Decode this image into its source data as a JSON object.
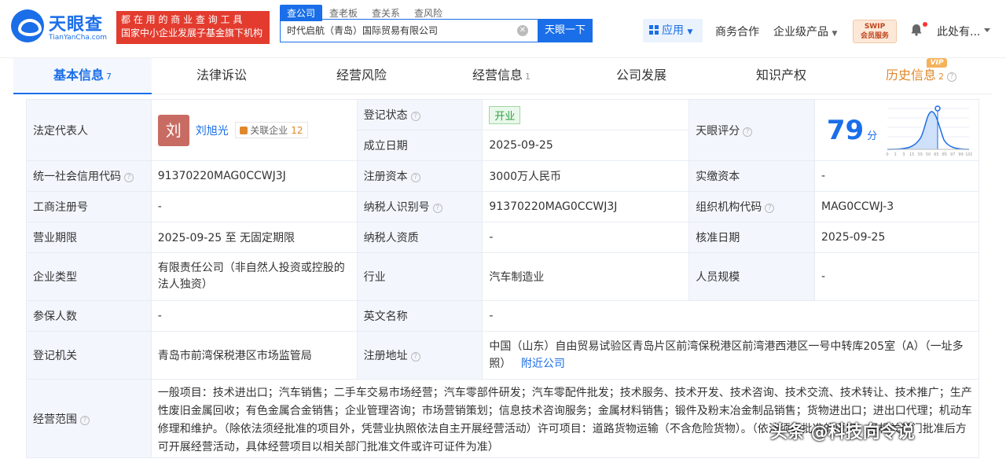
{
  "header": {
    "logo_cn": "天眼查",
    "logo_en": "TianYanCha.com",
    "slogan_line1": "都 在 用 的 商 业 查 询 工 具",
    "slogan_line2": "国家中小企业发展子基金旗下机构",
    "search_tabs": [
      "查公司",
      "查老板",
      "查关系",
      "查风险"
    ],
    "search_value": "时代启航（青岛）国际贸易有限公司",
    "search_button": "天眼一下",
    "app_label": "应用",
    "nav_business": "商务合作",
    "nav_enterprise": "企业级产品",
    "swip_line1": "SWIP",
    "swip_line2": "会员服务",
    "user_name": "此处有..."
  },
  "tabs": [
    {
      "label": "基本信息",
      "count": "7"
    },
    {
      "label": "法律诉讼",
      "count": ""
    },
    {
      "label": "经营风险",
      "count": ""
    },
    {
      "label": "经营信息",
      "count": "1"
    },
    {
      "label": "公司发展",
      "count": ""
    },
    {
      "label": "知识产权",
      "count": ""
    },
    {
      "label": "历史信息",
      "count": "2"
    }
  ],
  "vip_badge": "VIP",
  "info": {
    "legal_rep_label": "法定代表人",
    "legal_rep_avatar": "刘",
    "legal_rep_name": "刘旭光",
    "related_label": "关联企业",
    "related_count": "12",
    "reg_status_label": "登记状态",
    "reg_status_value": "开业",
    "found_date_label": "成立日期",
    "found_date_value": "2025-09-25",
    "score_label": "天眼评分",
    "score_value": "79",
    "score_unit": "分",
    "credit_code_label": "统一社会信用代码",
    "credit_code_value": "91370220MAG0CCWJ3J",
    "reg_capital_label": "注册资本",
    "reg_capital_value": "3000万人民币",
    "paid_capital_label": "实缴资本",
    "paid_capital_value": "-",
    "biz_reg_no_label": "工商注册号",
    "biz_reg_no_value": "-",
    "taxpayer_id_label": "纳税人识别号",
    "taxpayer_id_value": "91370220MAG0CCWJ3J",
    "org_code_label": "组织机构代码",
    "org_code_value": "MAG0CCWJ-3",
    "biz_term_label": "营业期限",
    "biz_term_value": "2025-09-25 至 无固定期限",
    "taxpayer_qual_label": "纳税人资质",
    "taxpayer_qual_value": "-",
    "approve_date_label": "核准日期",
    "approve_date_value": "2025-09-25",
    "company_type_label": "企业类型",
    "company_type_value": "有限责任公司（非自然人投资或控股的法人独资）",
    "industry_label": "行业",
    "industry_value": "汽车制造业",
    "staff_size_label": "人员规模",
    "staff_size_value": "-",
    "insured_label": "参保人数",
    "insured_value": "-",
    "english_name_label": "英文名称",
    "english_name_value": "-",
    "reg_authority_label": "登记机关",
    "reg_authority_value": "青岛市前湾保税港区市场监管局",
    "reg_address_label": "注册地址",
    "reg_address_value": "中国（山东）自由贸易试验区青岛片区前湾保税港区前湾港西港区一号中转库205室（A）（一址多照）",
    "nearby_link": "附近公司",
    "scope_label": "经营范围",
    "scope_value": "一般项目：技术进出口；汽车销售；二手车交易市场经营；汽车零部件研发；汽车零配件批发；技术服务、技术开发、技术咨询、技术交流、技术转让、技术推广；生产性废旧金属回收；有色金属合金销售；企业管理咨询；市场营销策划；信息技术咨询服务；金属材料销售；锻件及粉末冶金制品销售；货物进出口；进出口代理；机动车修理和维护。（除依法须经批准的项目外，凭营业执照依法自主开展经营活动）许可项目：道路货物运输（不含危险货物）。（依法须经批准的项目，经相关部门批准后方可开展经营活动，具体经营项目以相关部门批准文件或许可证件为准）"
  },
  "score_chart_ticks": [
    "0",
    "1",
    "3",
    "15",
    "30",
    "50",
    "65",
    "85",
    "97",
    "99",
    "100"
  ],
  "watermark": "头条 @科技向令说"
}
